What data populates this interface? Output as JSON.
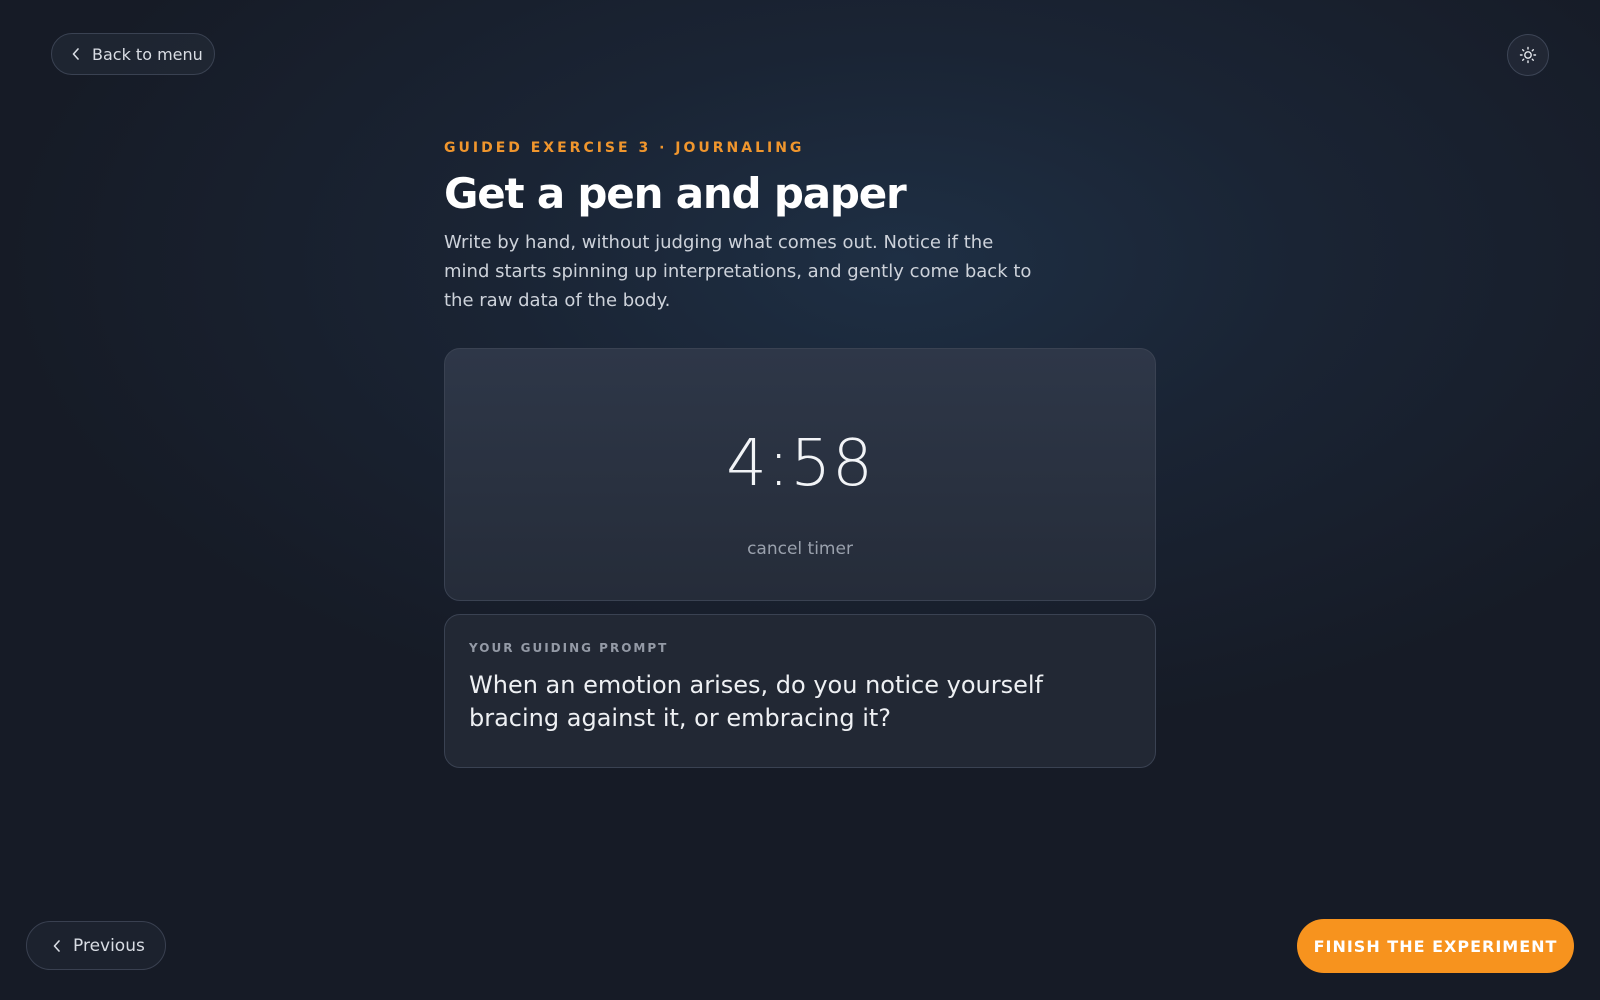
{
  "nav": {
    "back_label": "Back to menu",
    "back_icon": "chevron-left-icon",
    "theme_icon": "sun-icon"
  },
  "exercise": {
    "eyebrow": "GUIDED EXERCISE 3 · JOURNALING",
    "title": "Get a pen and paper",
    "description": "Write by hand, without judging what comes out. Notice if the mind starts spinning up interpretations, and gently come back to the raw data of the body."
  },
  "timer": {
    "value": "4:58",
    "cancel_label": "cancel timer"
  },
  "prompt": {
    "label": "YOUR GUIDING PROMPT",
    "text": "When an emotion arises, do you notice yourself bracing against it, or embracing it?"
  },
  "footer": {
    "previous_label": "Previous",
    "finish_label": "FINISH THE EXPERIMENT"
  },
  "colors": {
    "accent": "#f7931e",
    "eyebrow": "#f0962d",
    "background": "#161b26"
  }
}
